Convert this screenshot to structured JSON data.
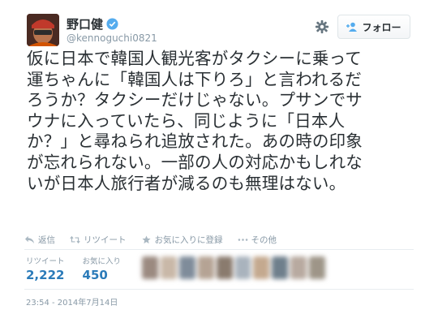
{
  "user": {
    "display_name": "野口健",
    "handle": "@kennoguchi0821"
  },
  "follow_button": {
    "label": "フォロー"
  },
  "tweet": {
    "text": "仮に日本で韓国人観光客がタクシーに乗って\n運ちゃんに「韓国人は下りろ」と言われるだ\nろうか？タクシーだけじゃない。プサンでサ\nウナに入っていたら、同じように「日本人\nか？」と尋ねられ追放された。あの時の印象\nが忘れられない。一部の人の対応かもしれな\nいが日本人旅行者が減るのも無理はない。"
  },
  "actions": [
    {
      "label": "返信",
      "icon": "reply-icon"
    },
    {
      "label": "リツイート",
      "icon": "retweet-icon"
    },
    {
      "label": "お気に入りに登録",
      "icon": "star-icon"
    },
    {
      "label": "その他",
      "icon": "more-icon"
    }
  ],
  "stats": {
    "retweets_label": "リツイート",
    "retweets_value": "2,222",
    "favorites_label": "お気に入り",
    "favorites_value": "450"
  },
  "timestamp": "23:54 - 2014年7月14日",
  "colors": {
    "link_blue": "#2b7bb9",
    "muted_gray": "#8899a6",
    "verified_blue": "#55acee"
  }
}
